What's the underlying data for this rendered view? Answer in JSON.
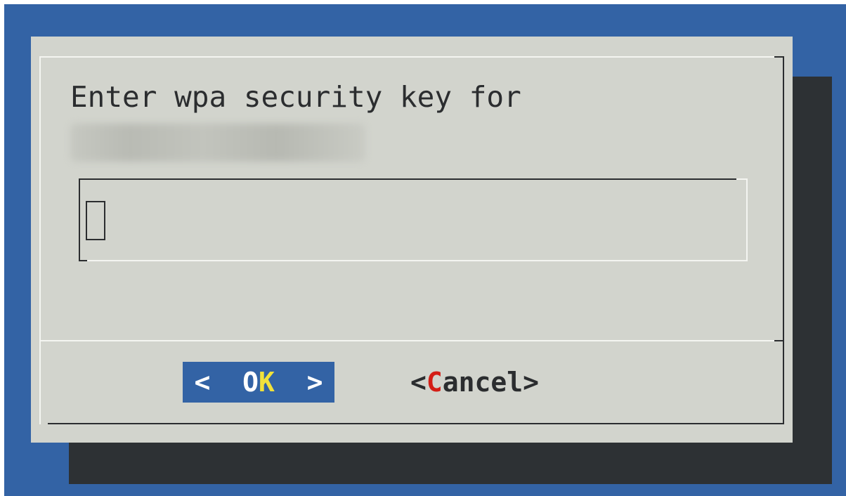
{
  "dialog": {
    "prompt": "Enter wpa security key for",
    "network_name_obscured": true
  },
  "input": {
    "value": "",
    "placeholder": ""
  },
  "buttons": {
    "ok": {
      "left_bracket": "<",
      "pre": "  O",
      "hotkey": "K",
      "post": "  ",
      "right_bracket": ">"
    },
    "cancel": {
      "pre": "<",
      "hotkey": "C",
      "post": "ancel>"
    }
  },
  "colors": {
    "screen_background": "#3363a5",
    "dialog_background": "#d2d4cd",
    "shadow": "#2d3134",
    "selected_button": "#3363a5",
    "ok_hotkey": "#f1e23a",
    "cancel_hotkey": "#d41e16",
    "text": "#2b2d2f"
  }
}
